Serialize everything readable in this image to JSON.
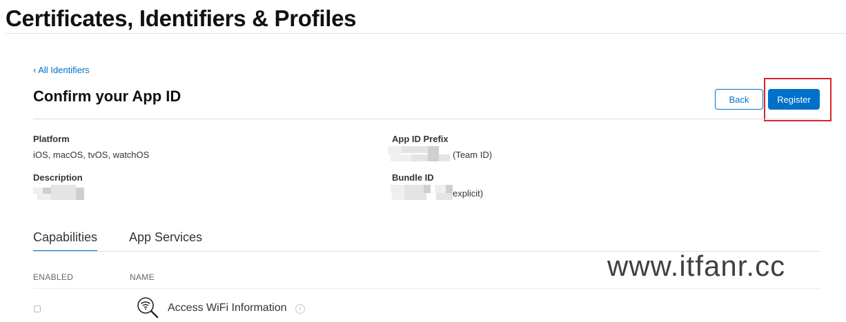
{
  "header": {
    "title": "Certificates, Identifiers & Profiles"
  },
  "breadcrumb": {
    "label": "‹ All Identifiers"
  },
  "page": {
    "heading": "Confirm your App ID"
  },
  "actions": {
    "back_label": "Back",
    "register_label": "Register"
  },
  "details": {
    "platform": {
      "label": "Platform",
      "value": "iOS, macOS, tvOS, watchOS"
    },
    "description": {
      "label": "Description",
      "value": ""
    },
    "app_id_prefix": {
      "label": "App ID Prefix",
      "suffix": "(Team ID)"
    },
    "bundle_id": {
      "label": "Bundle ID",
      "suffix": "explicit)"
    }
  },
  "tabs": [
    {
      "label": "Capabilities",
      "active": true
    },
    {
      "label": "App Services",
      "active": false
    }
  ],
  "table": {
    "columns": [
      "ENABLED",
      "NAME"
    ],
    "rows": [
      {
        "enabled": false,
        "name": "Access WiFi Information",
        "icon": "wifi-search-icon"
      }
    ]
  },
  "watermark": "www.itfanr.cc",
  "colors": {
    "accent": "#0070c9",
    "highlight": "#d9232a"
  }
}
